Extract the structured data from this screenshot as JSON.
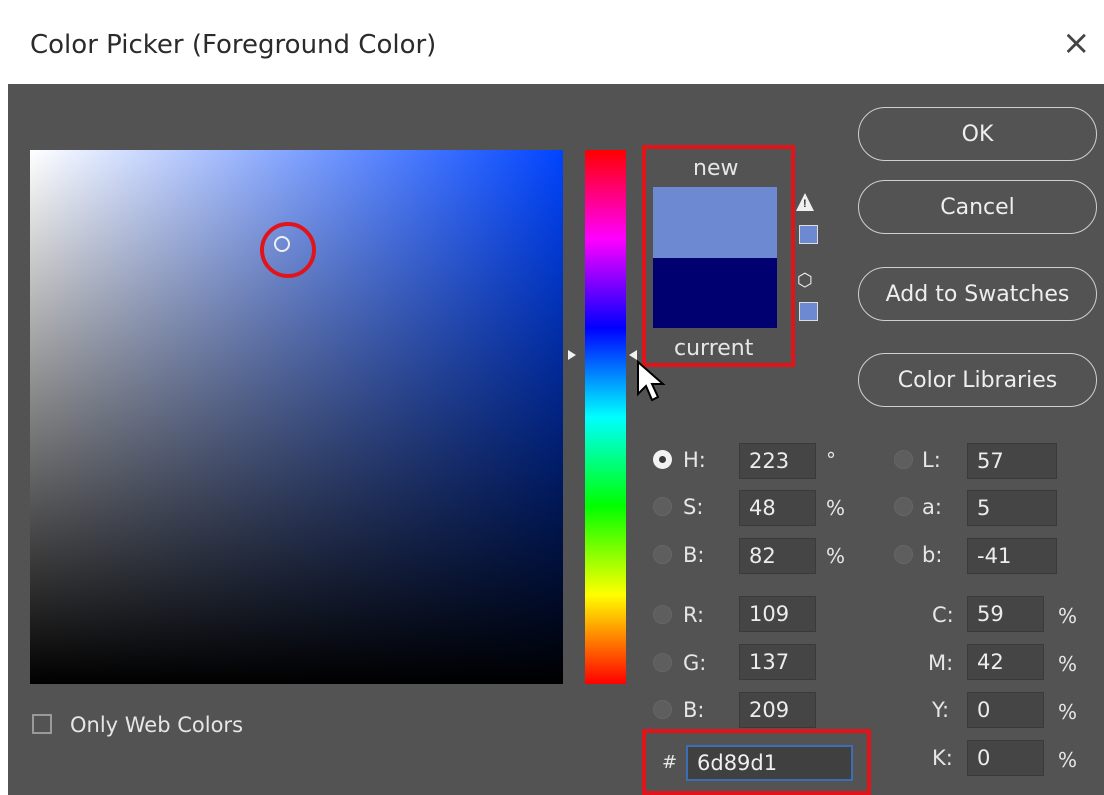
{
  "window": {
    "title": "Color Picker (Foreground Color)",
    "close_glyph": "×"
  },
  "colors": {
    "new": "#6d89d1",
    "current": "#000070",
    "highlight": "#e1141a"
  },
  "preview": {
    "new_label": "new",
    "current_label": "current"
  },
  "buttons": {
    "ok": "OK",
    "cancel": "Cancel",
    "add_to_swatches": "Add to Swatches",
    "color_libraries": "Color Libraries"
  },
  "hsb": {
    "h": {
      "label": "H:",
      "value": "223",
      "unit": "°"
    },
    "s": {
      "label": "S:",
      "value": "48",
      "unit": "%"
    },
    "b": {
      "label": "B:",
      "value": "82",
      "unit": "%"
    }
  },
  "rgb": {
    "r": {
      "label": "R:",
      "value": "109"
    },
    "g": {
      "label": "G:",
      "value": "137"
    },
    "b": {
      "label": "B:",
      "value": "209"
    }
  },
  "lab": {
    "l": {
      "label": "L:",
      "value": "57"
    },
    "a": {
      "label": "a:",
      "value": "5"
    },
    "b": {
      "label": "b:",
      "value": "-41"
    }
  },
  "cmyk": {
    "c": {
      "label": "C:",
      "value": "59",
      "unit": "%"
    },
    "m": {
      "label": "M:",
      "value": "42",
      "unit": "%"
    },
    "y": {
      "label": "Y:",
      "value": "0",
      "unit": "%"
    },
    "k": {
      "label": "K:",
      "value": "0",
      "unit": "%"
    }
  },
  "hex": {
    "label": "#",
    "value": "6d89d1"
  },
  "options": {
    "only_web_colors": "Only Web Colors"
  }
}
